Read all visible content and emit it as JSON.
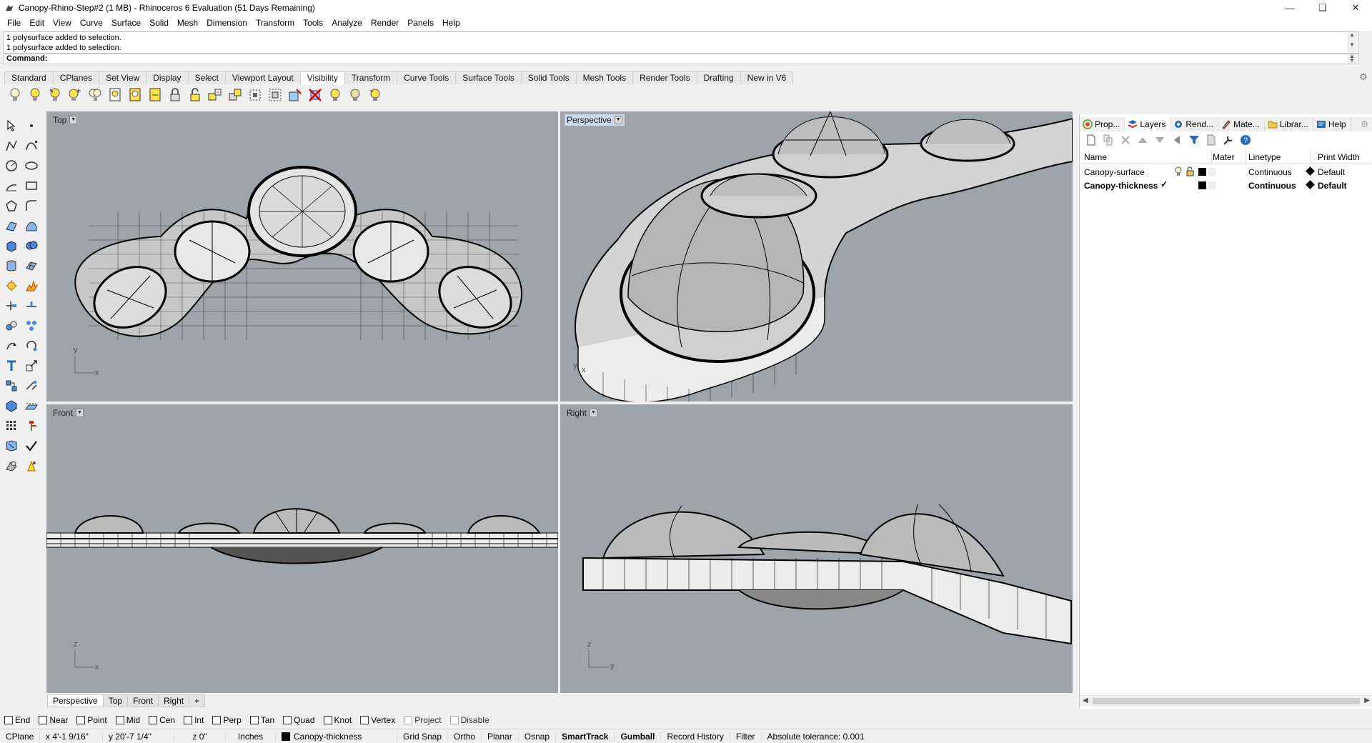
{
  "window": {
    "title": "Canopy-Rhino-Step#2 (1 MB) - Rhinoceros 6 Evaluation (51 Days Remaining)"
  },
  "menu": [
    "File",
    "Edit",
    "View",
    "Curve",
    "Surface",
    "Solid",
    "Mesh",
    "Dimension",
    "Transform",
    "Tools",
    "Analyze",
    "Render",
    "Panels",
    "Help"
  ],
  "command": {
    "history": [
      "1 polysurface added to selection.",
      "1 polysurface added to selection."
    ],
    "prompt": "Command:"
  },
  "toolbar_tabs": [
    "Standard",
    "CPlanes",
    "Set View",
    "Display",
    "Select",
    "Viewport Layout",
    "Visibility",
    "Transform",
    "Curve Tools",
    "Surface Tools",
    "Solid Tools",
    "Mesh Tools",
    "Render Tools",
    "Drafting",
    "New in V6"
  ],
  "active_toolbar_tab": "Visibility",
  "toolbar_icons": [
    "show-objects-icon",
    "hide-objects-icon",
    "show-selected-icon",
    "hide-swap-icon",
    "show-all-icon",
    "lock-page-icon",
    "lock-selected-icon",
    "lock-swap-icon",
    "lock-icon",
    "unlock-icon",
    "unlock-selected-icon",
    "lock-swap2-icon",
    "isolate-icon",
    "extract-icon",
    "select-hidden-icon",
    "delete-hidden-icon",
    "light-on-icon",
    "light-off-icon",
    "light-toggle-icon"
  ],
  "viewports": {
    "top": {
      "label": "Top",
      "axes": [
        "y",
        "x"
      ]
    },
    "perspective": {
      "label": "Perspective",
      "axes": [
        "y",
        "x"
      ]
    },
    "front": {
      "label": "Front",
      "axes": [
        "z",
        "x"
      ]
    },
    "right": {
      "label": "Right",
      "axes": [
        "z",
        "y"
      ]
    }
  },
  "viewport_tabs": [
    "Perspective",
    "Top",
    "Front",
    "Right",
    "+"
  ],
  "active_viewport_tab": "Perspective",
  "osnaps": [
    "End",
    "Near",
    "Point",
    "Mid",
    "Cen",
    "Int",
    "Perp",
    "Tan",
    "Quad",
    "Knot",
    "Vertex",
    "Project",
    "Disable"
  ],
  "status": {
    "cplane": "CPlane",
    "x": "x 4'-1 9/16\"",
    "y": "y 20'-7 1/4\"",
    "z": "z 0\"",
    "units": "Inches",
    "layer": "Canopy-thickness",
    "toggles": [
      "Grid Snap",
      "Ortho",
      "Planar",
      "Osnap",
      "SmartTrack",
      "Gumball",
      "Record History",
      "Filter"
    ],
    "bold_toggles": [
      "SmartTrack",
      "Gumball"
    ],
    "tolerance": "Absolute tolerance: 0.001"
  },
  "panel": {
    "tabs": [
      "Prop...",
      "Layers",
      "Rend...",
      "Mate...",
      "Librar...",
      "Help"
    ],
    "active_tab": "Layers",
    "columns": [
      "Name",
      "Mater",
      "Linetype",
      "Print Width"
    ],
    "layers": [
      {
        "name": "Canopy-surface",
        "linetype": "Continuous",
        "print_width": "Default",
        "current": false
      },
      {
        "name": "Canopy-thickness",
        "linetype": "Continuous",
        "print_width": "Default",
        "current": true
      }
    ]
  },
  "colors": {
    "viewport_bg": "#9fa4ab",
    "active_label": "#c9d9ee",
    "panel_bg": "#ffffff"
  }
}
